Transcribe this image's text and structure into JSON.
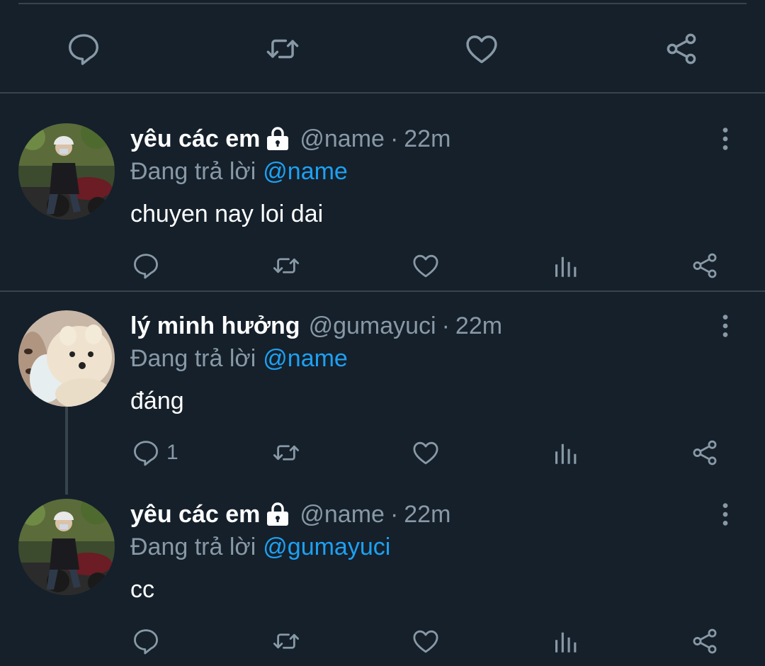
{
  "colors": {
    "background": "#15202b",
    "divider": "#38444d",
    "muted": "#8899a6",
    "mention": "#1da1f2",
    "text": "#ffffff"
  },
  "top_actions": [
    "reply-icon",
    "retweet-icon",
    "like-icon",
    "share-icon"
  ],
  "tweets": [
    {
      "name": "yêu các em",
      "locked": true,
      "handle": "@name",
      "dot": "·",
      "time": "22m",
      "replying_label": "Đang trả lời",
      "replying_to": "@name",
      "text": "chuyen nay loi dai",
      "reply_count": "",
      "avatar": "motorbike-rider-photo"
    },
    {
      "name": "lý minh hưởng",
      "locked": false,
      "handle": "@gumayuci",
      "dot": "·",
      "time": "22m",
      "replying_label": "Đang trả lời",
      "replying_to": "@name",
      "text": "đáng",
      "reply_count": "1",
      "avatar": "white-puppy-photo"
    },
    {
      "name": "yêu các em",
      "locked": true,
      "handle": "@name",
      "dot": "·",
      "time": "22m",
      "replying_label": "Đang trả lời",
      "replying_to": "@gumayuci",
      "text": "cc",
      "reply_count": "",
      "avatar": "motorbike-rider-photo"
    }
  ]
}
